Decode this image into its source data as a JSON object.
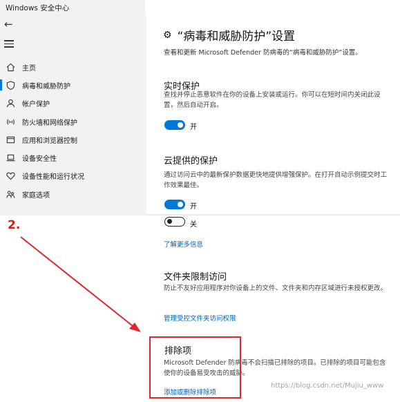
{
  "window": {
    "title": "Windows 安全中心"
  },
  "sidebar": {
    "items": [
      {
        "label": "主页",
        "icon": "home-icon",
        "active": false
      },
      {
        "label": "病毒和威胁防护",
        "icon": "shield-icon",
        "active": true
      },
      {
        "label": "帐户保护",
        "icon": "person-icon",
        "active": false
      },
      {
        "label": "防火墙和网络保护",
        "icon": "wifi-signal-icon",
        "active": false
      },
      {
        "label": "应用和浏览器控制",
        "icon": "app-window-icon",
        "active": false
      },
      {
        "label": "设备安全性",
        "icon": "laptop-icon",
        "active": false
      },
      {
        "label": "设备性能和运行状况",
        "icon": "heart-icon",
        "active": false
      },
      {
        "label": "家庭选项",
        "icon": "family-icon",
        "active": false
      }
    ]
  },
  "main": {
    "title": "“病毒和威胁防护”设置",
    "description": "查看和更新 Microsoft Defender 防病毒的“病毒和威胁防护”设置。",
    "realtime": {
      "title": "实时保护",
      "description": "查找并停止恶意软件在你的设备上安装或运行。你可以在短时间内关闭此设置，然后自动开启。",
      "toggle_label": "开"
    },
    "cloud": {
      "title": "云提供的保护",
      "description": "通过访问云中的最新保护数据更快地提供增强保护。在打开自动示例提交时工作效果最佳。",
      "toggle_on_label": "开",
      "toggle_off_label": "关",
      "learn_more": "了解更多信息"
    },
    "folder_access": {
      "title": "文件夹限制访问",
      "description": "防止不友好应用程序对你设备上的文件、文件夹和内存区域进行未授权更改。",
      "link": "管理受控文件夹访问权限"
    },
    "exclusions": {
      "title": "排除项",
      "description": "Microsoft Defender 防病毒不会扫描已排除的项目。已排除的项目可能包含使你的设备易受攻击的威胁。",
      "link": "添加或删除排除项"
    }
  },
  "annotation": {
    "step": "2.",
    "color": "#e0262a"
  },
  "watermark": "https://blog.csdn.net/Mujiu_www",
  "colors": {
    "accent": "#0078d7",
    "link": "#0063b1",
    "sidebar_bg": "#f2f2f2"
  }
}
